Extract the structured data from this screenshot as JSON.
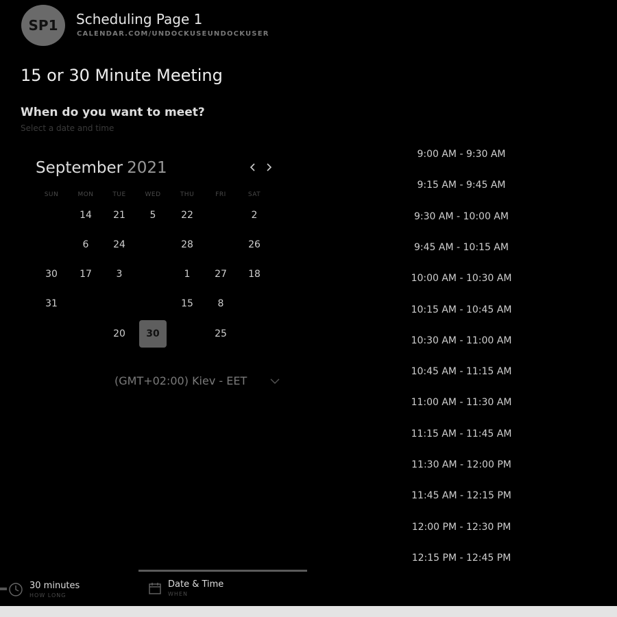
{
  "header": {
    "avatar_initials": "SP1",
    "page_name": "Scheduling Page 1",
    "page_url": "CALENDAR.COM/UNDOCKUSEUNDOCKUSER"
  },
  "event": {
    "title": "15 or 30 Minute Meeting",
    "question": "When do you want to meet?",
    "hint": "Select a date and time"
  },
  "calendar": {
    "month": "September",
    "year": "2021",
    "weekdays": [
      "SUN",
      "MON",
      "TUE",
      "WED",
      "THU",
      "FRI",
      "SAT"
    ],
    "rows": [
      [
        "",
        "14",
        "21",
        "5",
        "22",
        "",
        "2"
      ],
      [
        "",
        "6",
        "24",
        "",
        "28",
        "",
        "26"
      ],
      [
        "30",
        "17",
        "3",
        "",
        "1",
        "27",
        "18"
      ],
      [
        "31",
        "",
        "",
        "",
        "15",
        "8",
        ""
      ],
      [
        "",
        "",
        "20",
        "30",
        "",
        "25",
        ""
      ]
    ],
    "selected_day": "30"
  },
  "timezone": {
    "value": "(GMT+02:00) Kiev - EET"
  },
  "time_slots": [
    "9:00 AM - 9:30 AM",
    "9:15 AM - 9:45 AM",
    "9:30 AM - 10:00 AM",
    "9:45 AM - 10:15 AM",
    "10:00 AM - 10:30 AM",
    "10:15 AM - 10:45 AM",
    "10:30 AM - 11:00 AM",
    "10:45 AM - 11:15 AM",
    "11:00 AM - 11:30 AM",
    "11:15 AM - 11:45 AM",
    "11:30 AM - 12:00 PM",
    "11:45 AM - 12:15 PM",
    "12:00 PM - 12:30 PM",
    "12:15 PM - 12:45 PM"
  ],
  "steps": {
    "duration": {
      "label": "30 minutes",
      "sub": "HOW LONG"
    },
    "datetime": {
      "label": "Date & Time",
      "sub": "WHEN"
    }
  },
  "colors": {
    "background": "#000000",
    "selected_day_bg": "#5e5e5e",
    "footer_bar": "#e4e4e4"
  }
}
